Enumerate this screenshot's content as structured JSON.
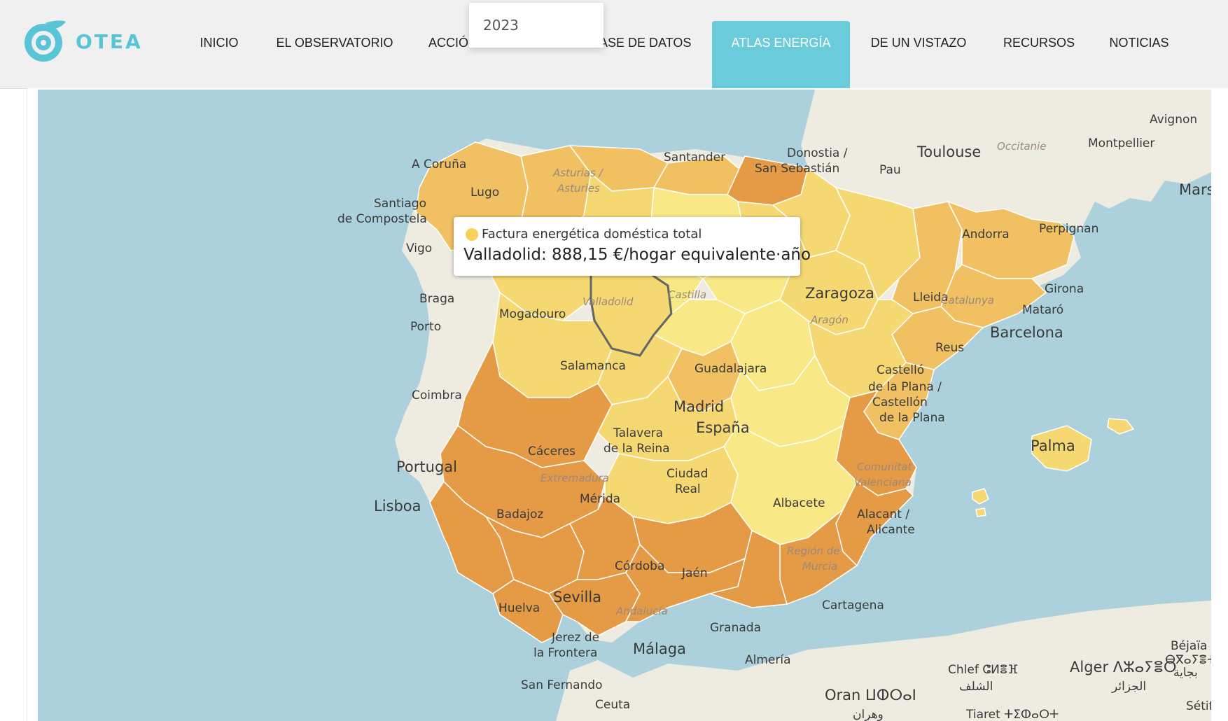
{
  "logo": {
    "text": "OTEA"
  },
  "nav": {
    "items": [
      {
        "label": "INICIO",
        "active": false
      },
      {
        "label": "EL OBSERVATORIO",
        "active": false
      },
      {
        "label": "ACCIÓ",
        "active": false
      },
      {
        "label": "ASE DE DATOS",
        "active": false
      },
      {
        "label": "ATLAS ENERGÍA",
        "active": true
      },
      {
        "label": "DE UN VISTAZO",
        "active": false
      },
      {
        "label": "RECURSOS",
        "active": false
      },
      {
        "label": "NOTICIAS",
        "active": false
      }
    ]
  },
  "year_dropdown": {
    "value": "2023"
  },
  "tooltip": {
    "series": "Factura energética doméstica total",
    "value_text": "Valladolid: 888,15 €/hogar equivalente·año"
  },
  "map": {
    "highlighted": "Valladolid",
    "colors": {
      "sea": "#acd0dc",
      "land": "#eeebe0",
      "light_yellow": "#f9e986",
      "yellow": "#f5d872",
      "light_orange": "#f0c062",
      "orange": "#ebaa52",
      "dark_orange": "#e59a45"
    },
    "labels": {
      "avignon": "Avignon",
      "montpellier": "Montpellier",
      "toulouse": "Toulouse",
      "occitanie": "Occitanie",
      "pau": "Pau",
      "marse": "Marse",
      "perpignan": "Perpignan",
      "andorra": "Andorra",
      "santander": "Santander",
      "donostia": "Donostia /",
      "san_sebastian": "San Sebastián",
      "a_coruna": "A Coruña",
      "santiago": "Santiago",
      "de_compostela": "de Compostela",
      "lugo": "Lugo",
      "asturias": "Asturias /",
      "asturies": "Asturies",
      "vigo": "Vigo",
      "braga": "Braga",
      "mogadouro": "Mogadouro",
      "porto": "Porto",
      "coimbra": "Coimbra",
      "portugal": "Portugal",
      "lisboa": "Lisboa",
      "valladolid": "Valladolid",
      "castilla": "Castilla",
      "zaragoza": "Zaragoza",
      "aragon": "Aragón",
      "lleida": "Lleida",
      "catalunya": "Catalunya",
      "girona": "Girona",
      "mataro": "Mataró",
      "barcelona": "Barcelona",
      "reus": "Reus",
      "salamanca": "Salamanca",
      "guadalajara": "Guadalajara",
      "madrid": "Madrid",
      "espana": "España",
      "castello1": "Castelló",
      "castello2": "de la Plana /",
      "castello3": "Castellón",
      "castello4": "de la Plana",
      "talavera1": "Talavera",
      "talavera2": "de la Reina",
      "caceres": "Cáceres",
      "extremadura": "Extremadura",
      "merida": "Mérida",
      "badajoz": "Badajoz",
      "ciudad1": "Ciudad",
      "ciudad2": "Real",
      "albacete": "Albacete",
      "comunitat1": "Comunitat",
      "comunitat2": "Valenciana",
      "palma": "Palma",
      "alacant1": "Alacant /",
      "alacant2": "Alicante",
      "cordoba": "Córdoba",
      "jaen": "Jaén",
      "murcia1": "Región de",
      "murcia2": "Murcia",
      "sevilla": "Sevilla",
      "andalucia": "Andalucía",
      "huelva": "Huelva",
      "jerez1": "Jerez de",
      "jerez2": "la Frontera",
      "malaga": "Málaga",
      "granada": "Granada",
      "almeria": "Almería",
      "cartagena": "Cartagena",
      "san_fernando": "San Fernando",
      "ceuta": "Ceuta",
      "oran": "Oran ⵡⵀⵔⴰⵏ",
      "wahran": "وهران",
      "chlef": "Chlef ⵛⵍⴻⴼ",
      "chlef_ar": "الشلف",
      "alger": "Alger ⴷⵣⴰⵢⴻⵔ",
      "alger_ar": "الجزائر",
      "bejaia": "Béjaïa",
      "bejaia_tf": "ⴱⴳⴰⵢⴻⵜ",
      "bejaia_ar": "بجاية",
      "tiaret": "Tiaret ⵜⵉⵀⴰⵔⵜ",
      "setif": "Sétif"
    }
  }
}
